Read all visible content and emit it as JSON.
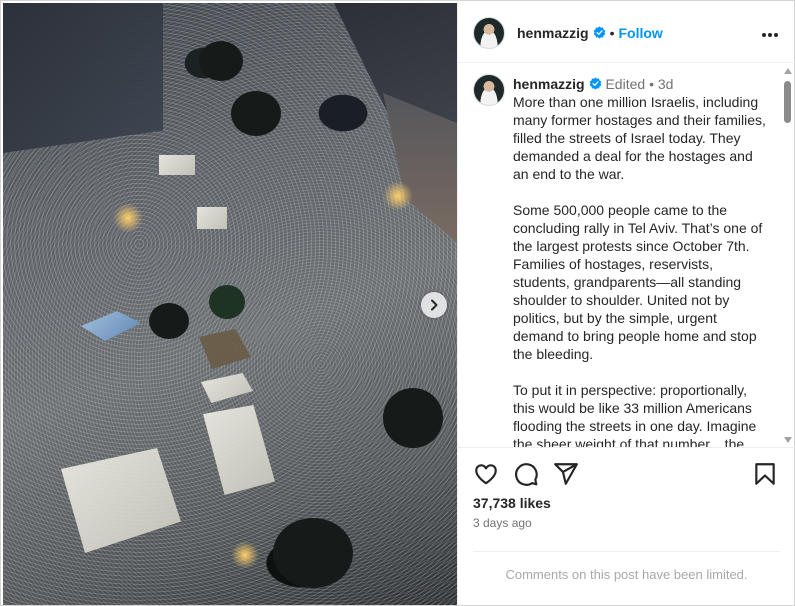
{
  "post": {
    "username": "henmazzig",
    "follow_label": "Follow",
    "header_separator": "•",
    "more_icon": "more-horizontal-icon",
    "verified_icon": "verified-badge-icon"
  },
  "caption": {
    "username": "henmazzig",
    "edited_label": "Edited",
    "meta_separator": "•",
    "age": "3d",
    "paragraphs": [
      "More than one million Israelis, including many former hostages and their families, filled the streets of Israel today. They demanded a deal for the hostages and an end to the war.",
      "Some 500,000 people came to the concluding rally in Tel Aviv. That’s one of the largest protests since October 7th. Families of hostages, reservists, students, grandparents—all standing shoulder to shoulder. United not by politics, but by the simple, urgent demand to bring people home and stop the bleeding.",
      "To put it in perspective: proportionally, this would be like 33 million Americans flooding the streets in one day. Imagine the sheer weight of that number... the"
    ]
  },
  "actions": {
    "like_icon": "heart-icon",
    "comment_icon": "comment-icon",
    "share_icon": "share-icon",
    "save_icon": "bookmark-icon",
    "likes": "37,738 likes",
    "date": "3 days ago",
    "comments_notice": "Comments on this post have been limited."
  },
  "media": {
    "next_icon": "chevron-right-icon"
  },
  "colors": {
    "link_blue": "#0095f6",
    "verified_blue": "#0095f6",
    "muted_text": "#737373",
    "limited_text": "#a8a8a8"
  }
}
